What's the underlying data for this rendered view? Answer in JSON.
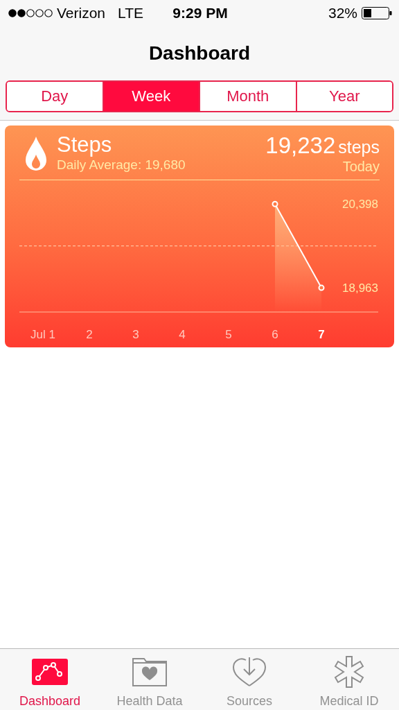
{
  "status_bar": {
    "carrier": "Verizon",
    "network": "LTE",
    "time": "9:29 PM",
    "battery": "32%"
  },
  "nav": {
    "title": "Dashboard"
  },
  "segments": [
    {
      "label": "Day",
      "selected": false
    },
    {
      "label": "Week",
      "selected": true
    },
    {
      "label": "Month",
      "selected": false
    },
    {
      "label": "Year",
      "selected": false
    }
  ],
  "card": {
    "title": "Steps",
    "subtitle": "Daily Average: 19,680",
    "value": "19,232",
    "unit": "steps",
    "period": "Today",
    "chart_data": {
      "type": "line",
      "categories": [
        "Jul 1",
        "2",
        "3",
        "4",
        "5",
        "6",
        "7"
      ],
      "series": [
        {
          "color": "#ffffff",
          "marker": "circle",
          "values": [
            null,
            null,
            null,
            null,
            null,
            20398,
            18963
          ]
        }
      ],
      "ylim": [
        18548,
        21744
      ],
      "yticks": [
        {
          "value": 20398,
          "label": "20,398"
        },
        {
          "value": 18963,
          "label": "18,963"
        }
      ],
      "ref_lines": [
        {
          "axis": "y",
          "value": 19680
        }
      ]
    }
  },
  "tab_bar": [
    {
      "label": "Dashboard",
      "selected": true
    },
    {
      "label": "Health Data",
      "selected": false
    },
    {
      "label": "Sources",
      "selected": false
    },
    {
      "label": "Medical ID",
      "selected": false
    }
  ]
}
